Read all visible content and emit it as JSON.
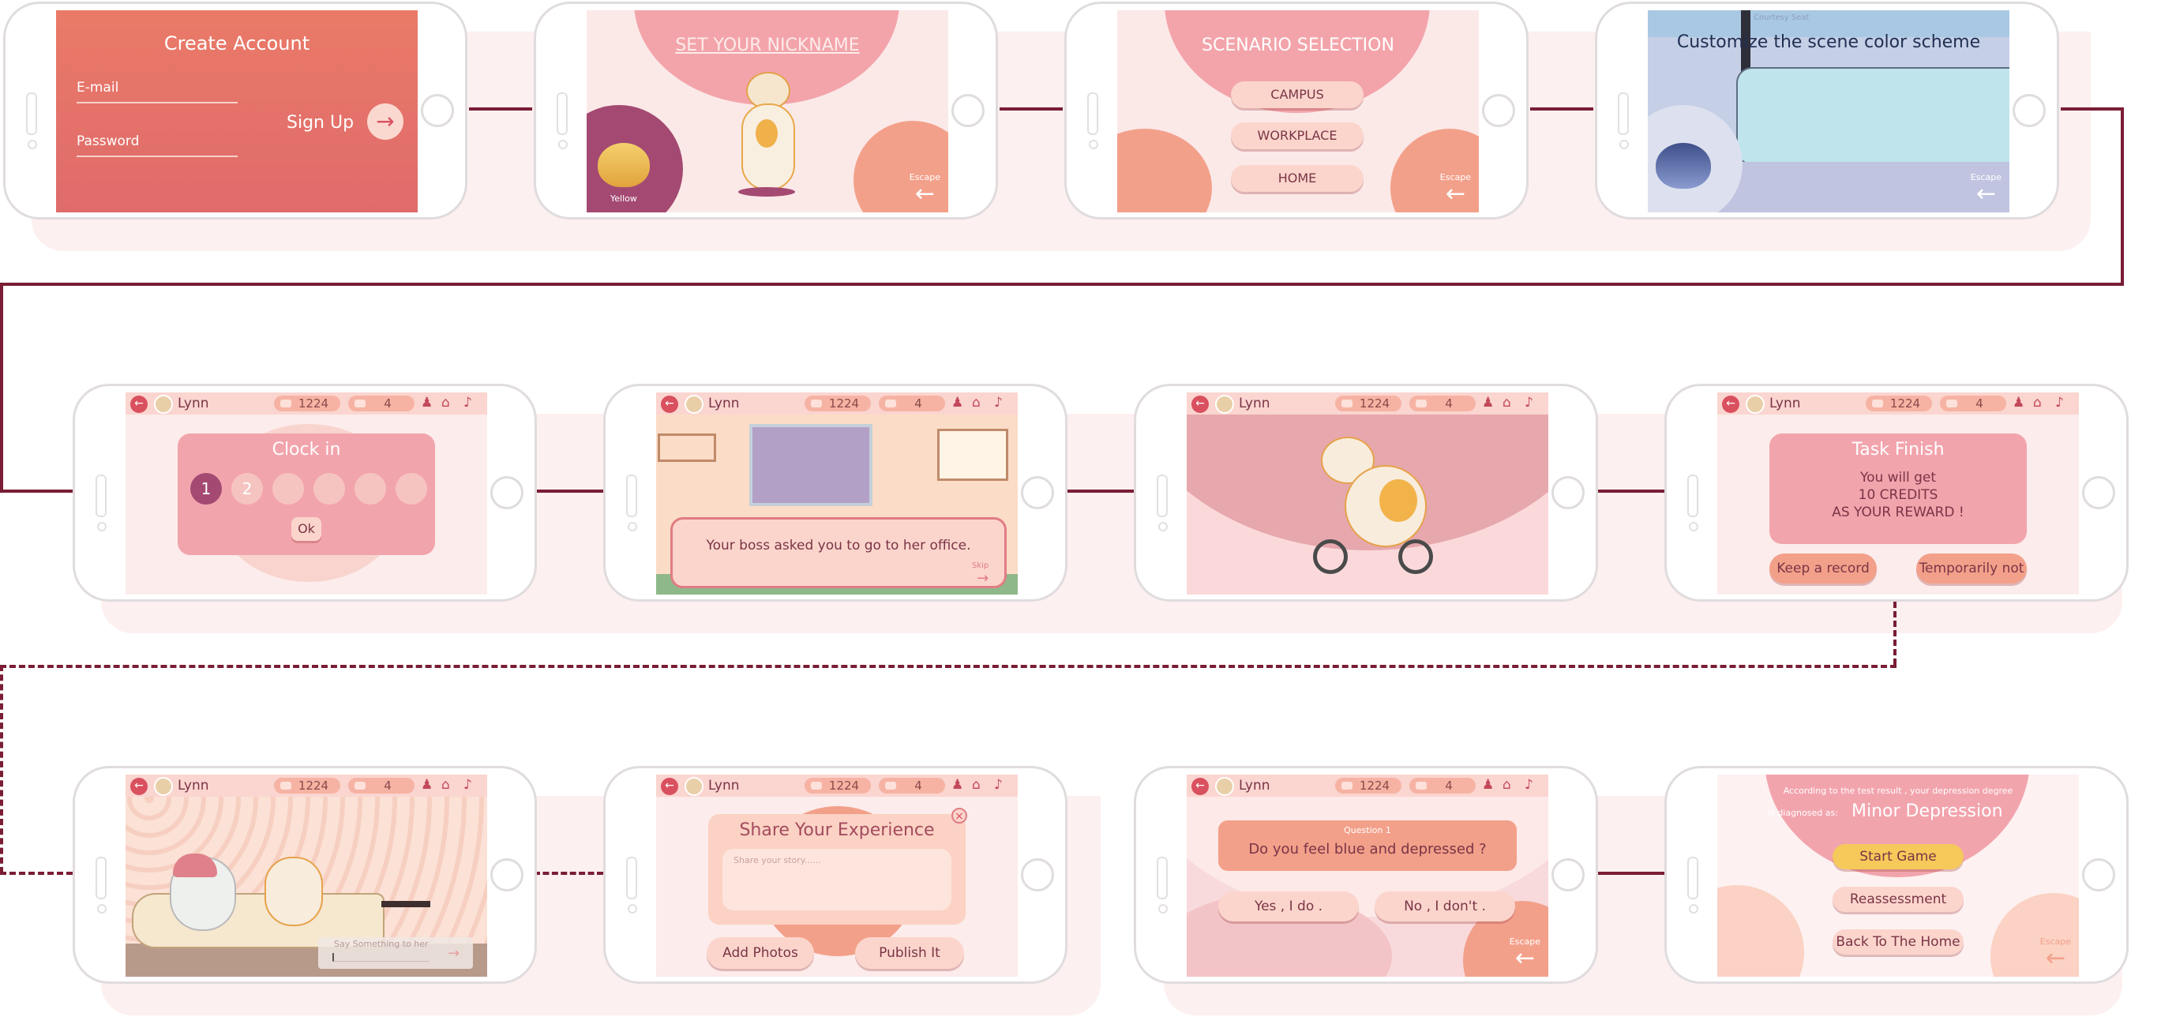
{
  "screens": {
    "s1": {
      "title": "Create Account",
      "email_label": "E-mail",
      "password_label": "Password",
      "signup_label": "Sign Up",
      "arrow": "→"
    },
    "s2": {
      "title": "SET YOUR NICKNAME",
      "color_label": "Yellow",
      "escape_label": "Escape",
      "arrow": "←"
    },
    "s3": {
      "title": "SCENARIO SELECTION",
      "options": [
        "CAMPUS",
        "WORKPLACE",
        "HOME"
      ],
      "escape_label": "Escape",
      "arrow": "←"
    },
    "s4": {
      "title": "Customize the scene color scheme",
      "sign": "Courtesy Seat",
      "escape_label": "Escape",
      "arrow": "←"
    },
    "s5": {
      "title": "Clock in",
      "days": [
        "1",
        "2",
        "",
        "",
        "",
        ""
      ],
      "ok_label": "Ok"
    },
    "s6": {
      "dialog": "Your boss asked you to go to her office.",
      "skip_label": "Skip",
      "arrow": "→"
    },
    "s8": {
      "title": "Task Finish",
      "line1": "You will get",
      "line2": "10 CREDITS",
      "line3": "AS YOUR REWARD !",
      "keep_label": "Keep a record",
      "later_label": "Temporarily not"
    },
    "s9": {
      "chat_placeholder": "Say Something to her",
      "arrow": "→"
    },
    "s10": {
      "title": "Share Your Experience",
      "placeholder": "Share your story......",
      "photos_label": "Add Photos",
      "publish_label": "Publish It",
      "close": "×"
    },
    "s11": {
      "question_label": "Question 1",
      "question": "Do you feel blue and depressed ?",
      "yes_label": "Yes , I do .",
      "no_label": "No , I don't .",
      "escape_label": "Escape",
      "arrow": "←"
    },
    "s12": {
      "result_line": "According to the test result , your depression degree",
      "diag_prefix": "is diagnosed as:",
      "diagnosis": "Minor Depression",
      "start_label": "Start Game",
      "reassess_label": "Reassessment",
      "home_label": "Back To The Home",
      "escape_label": "Escape",
      "arrow": "←"
    }
  },
  "hud": {
    "back": "←",
    "user": "Lynn",
    "coins": "1224",
    "hearts": "4",
    "icons": [
      "♟",
      "⌂",
      "♪"
    ]
  },
  "colors": {
    "accent": "#7a1d35",
    "pink": "#f2a4ad",
    "salmon": "#f3a08a",
    "band": "#fdf0f0"
  }
}
